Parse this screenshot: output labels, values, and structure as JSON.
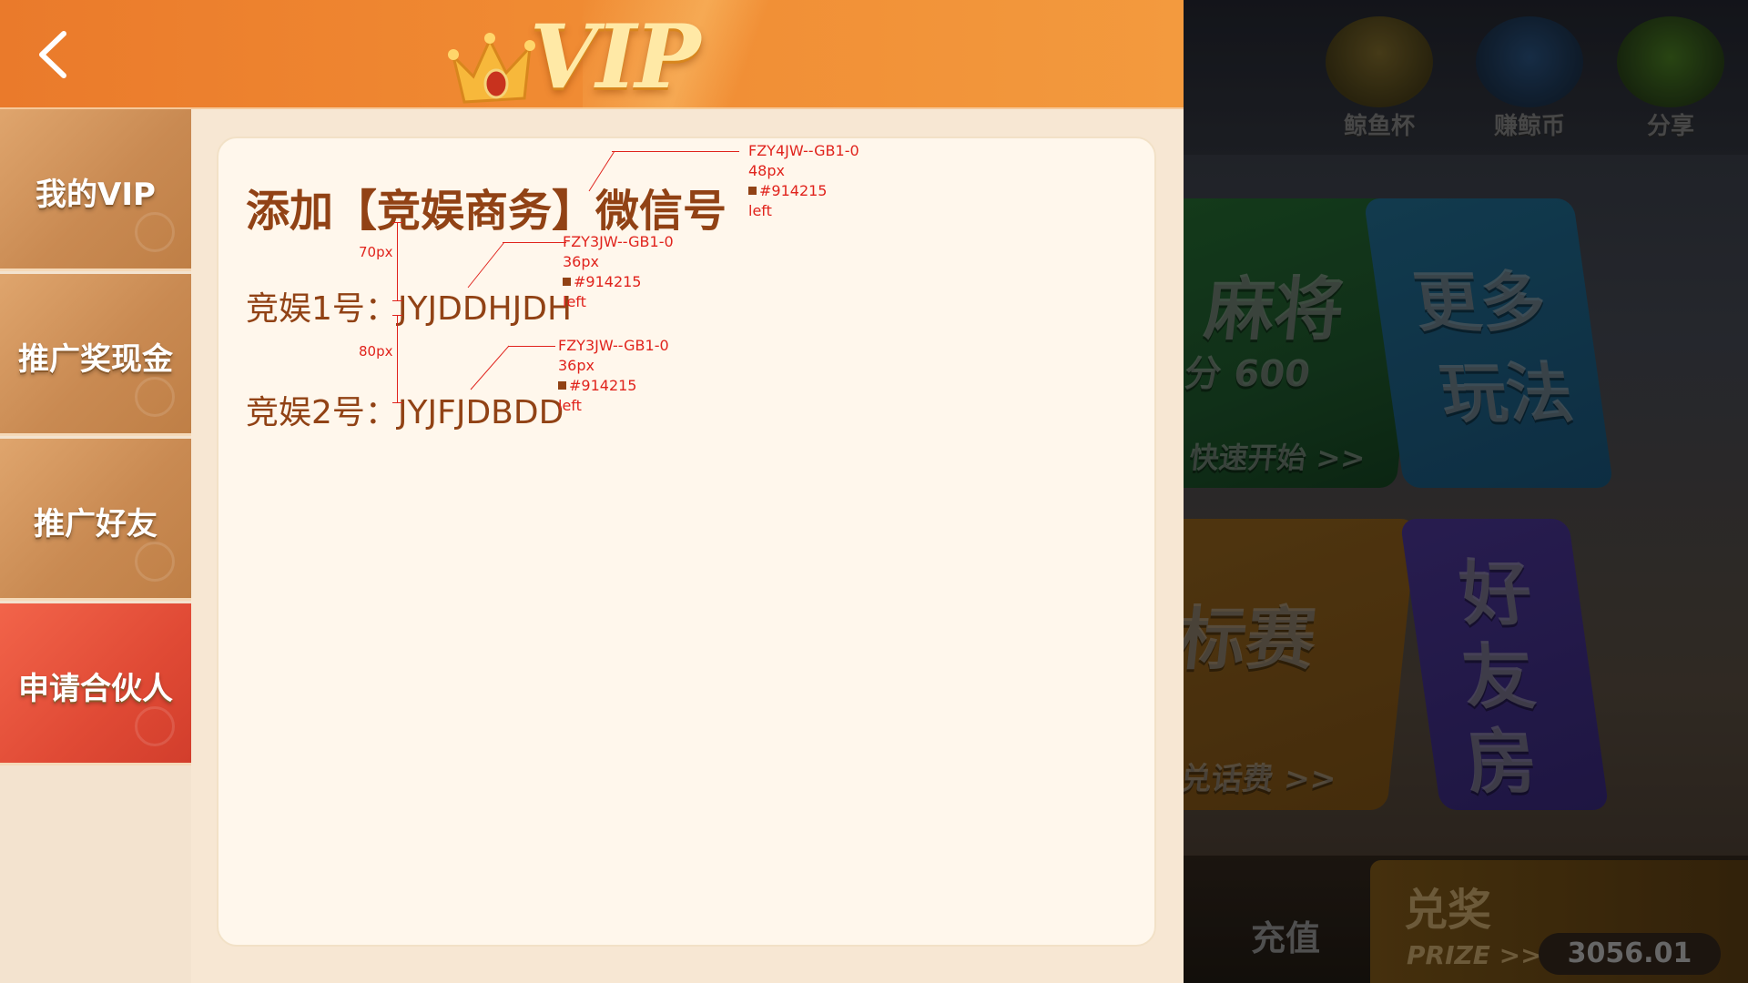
{
  "header": {
    "logo_text": "VIP"
  },
  "sidebar": {
    "items": [
      {
        "label": "我的VIP"
      },
      {
        "label": "推广奖现金"
      },
      {
        "label": "推广好友"
      },
      {
        "label": "申请合伙人",
        "active": true
      }
    ]
  },
  "content": {
    "title": "添加【竞娱商务】微信号",
    "accounts": [
      {
        "label": "竞娱1号：",
        "value": "JYJDDHJDH"
      },
      {
        "label": "竞娱2号：",
        "value": "JYJFJDBDD"
      }
    ]
  },
  "annotations": {
    "title_spec": {
      "font": "FZY4JW--GB1-0",
      "size": "48px",
      "color": "#914215",
      "align": "left"
    },
    "line1_spec": {
      "font": "FZY3JW--GB1-0",
      "size": "36px",
      "color": "#914215",
      "align": "left"
    },
    "line2_spec": {
      "font": "FZY3JW--GB1-0",
      "size": "36px",
      "color": "#914215",
      "align": "left"
    },
    "gap1": "70px",
    "gap2": "80px"
  },
  "background": {
    "top_icons": [
      {
        "label": "鲸鱼杯",
        "icon": "trophy-icon"
      },
      {
        "label": "赚鲸币",
        "icon": "whale-icon"
      },
      {
        "label": "分享",
        "icon": "wechat-icon"
      }
    ],
    "tiles": {
      "mahjong_title": "麻将",
      "mahjong_score": "分 600",
      "mahjong_action": "快速开始 >>",
      "more_line1": "更多",
      "more_line2": "玩法",
      "tournament_title": "标赛",
      "tournament_action": "兑话费 >>",
      "friend_room": [
        "好",
        "友",
        "房"
      ]
    },
    "bottom": {
      "recharge": "充值",
      "prize_title": "兑奖",
      "prize_sub": "PRIZE >>",
      "prize_amount": "3056.01"
    }
  },
  "colors": {
    "text_brown": "#914215",
    "annotation_red": "#e0231c",
    "header_orange": "#f08a32",
    "sidebar_active": "#e04a35",
    "sidebar_normal": "#c98a52",
    "card_bg": "#fff7ec"
  }
}
